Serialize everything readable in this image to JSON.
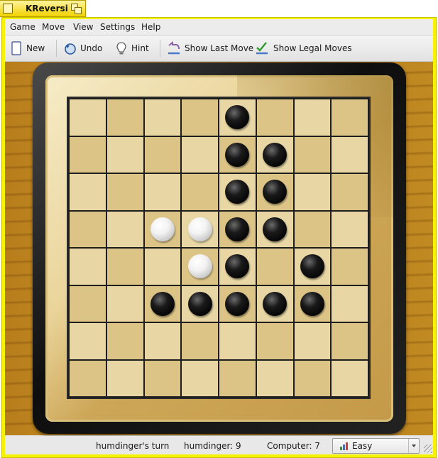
{
  "window": {
    "title": "KReversi"
  },
  "menu": [
    "Game",
    "Move",
    "View",
    "Settings",
    "Help"
  ],
  "toolbar": {
    "new_label": "New",
    "undo_label": "Undo",
    "hint_label": "Hint",
    "last_move_label": "Show Last Move",
    "legal_moves_label": "Show Legal Moves"
  },
  "board": {
    "size": 8,
    "rows": [
      "....B...",
      "....BB..",
      "....BB..",
      "..WWBB..",
      "...WB.B.",
      "..BBBBB.",
      "........",
      "........"
    ]
  },
  "status": {
    "turn": "humdinger's turn",
    "player_score": "humdinger: 9",
    "computer_score": "Computer: 7",
    "difficulty": "Easy"
  },
  "colors": {
    "frame": "#f6f300",
    "board_cell": "#dcc487",
    "wood": "#c18a22"
  }
}
